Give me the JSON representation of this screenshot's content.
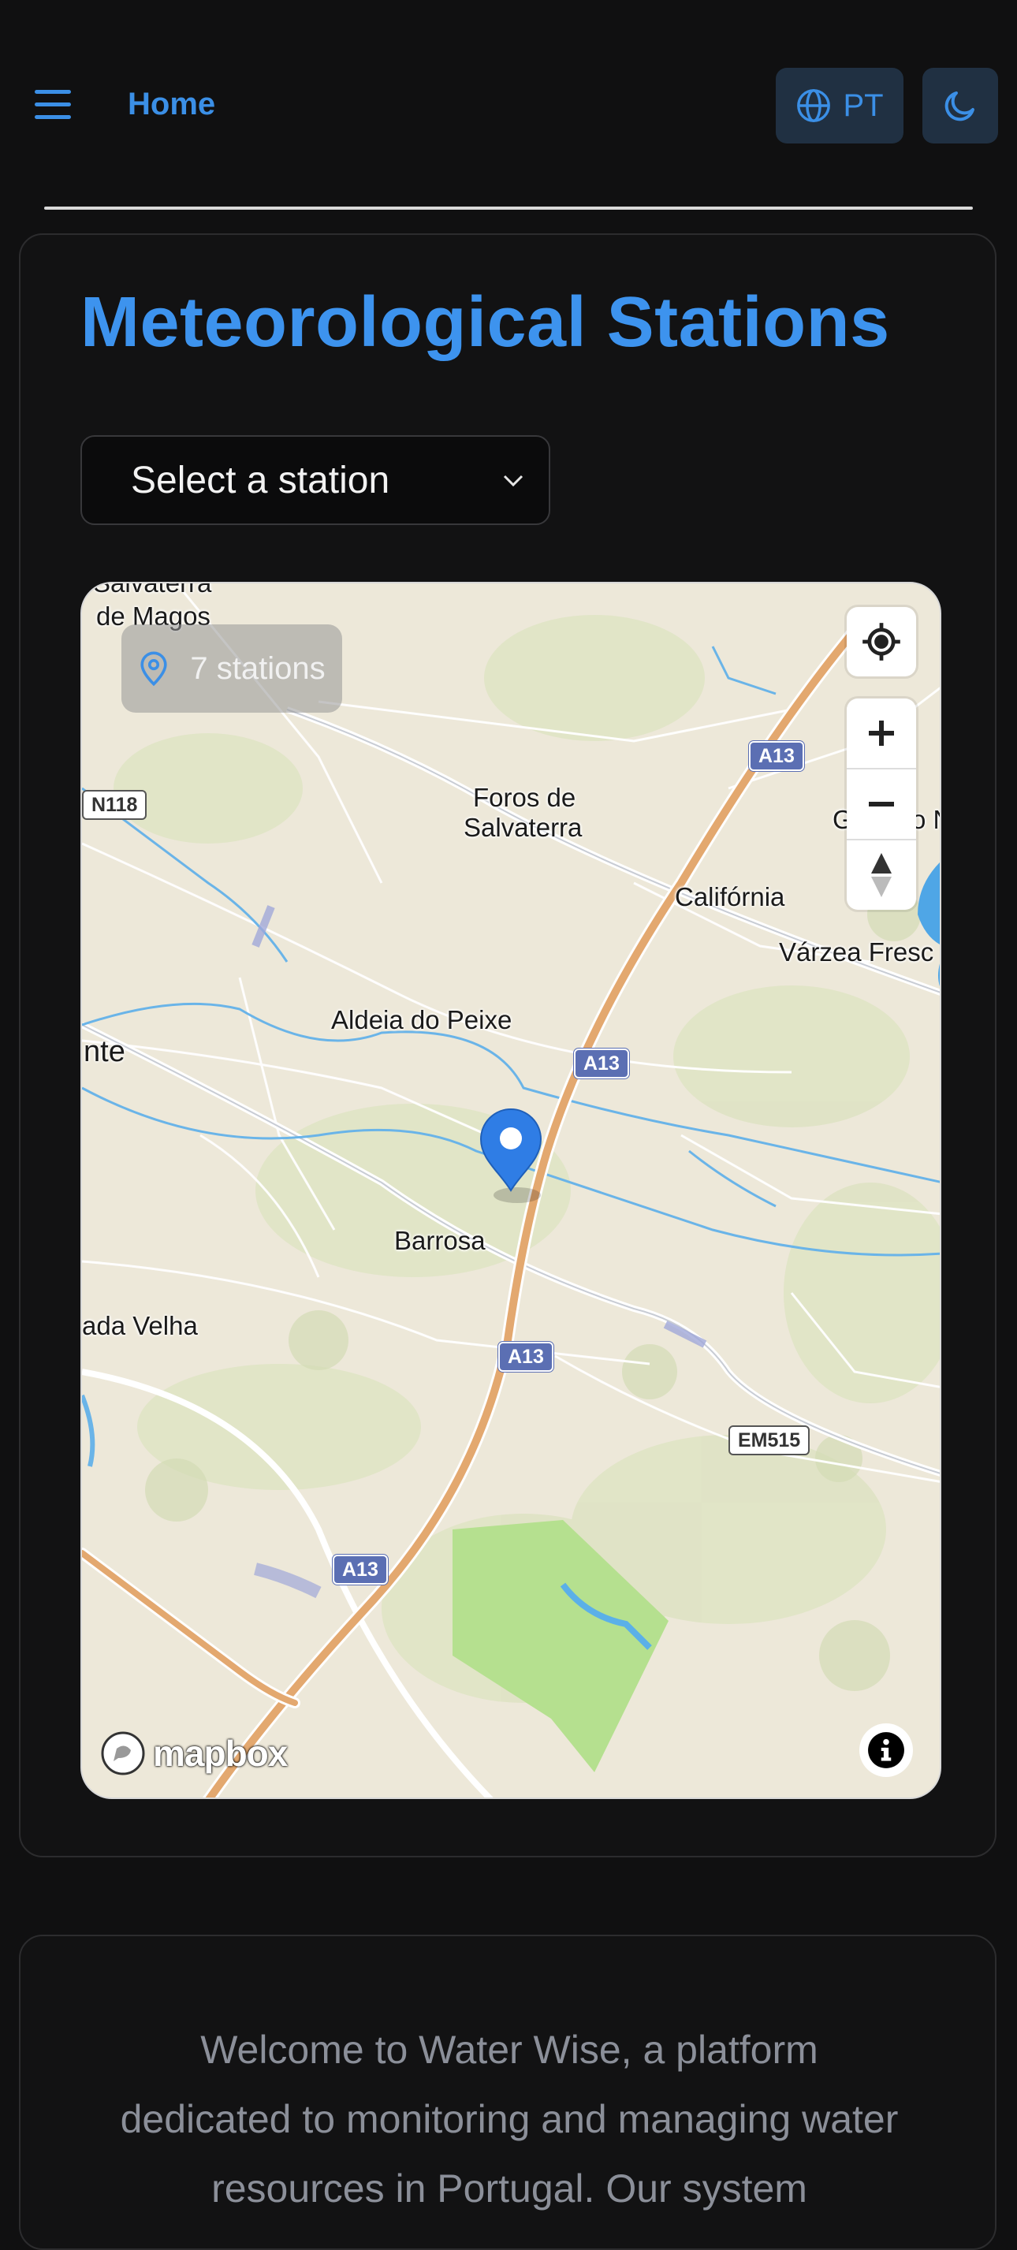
{
  "header": {
    "home_label": "Home",
    "language_label": "PT",
    "accent_color": "#3b8fe6"
  },
  "stations": {
    "title": "Meteorological Stations",
    "select_placeholder": "Select a station",
    "stations_count_label": "7 stations"
  },
  "map": {
    "attribution": "mapbox",
    "place_labels": {
      "salvaterra": "Salvaterra",
      "de_magos": "de Magos",
      "foros_line1": "Foros de",
      "foros_line2": "Salvaterra",
      "california": "Califórnia",
      "varzea": "Várzea Fresc",
      "gnorth": "G",
      "gnorth_tail": "o N",
      "aldeia": "Aldeia do Peixe",
      "nte": "nte",
      "barrosa": "Barrosa",
      "ada_velha": "ada Velha"
    },
    "road_shields": {
      "n118": "N118",
      "a13_top": "A13",
      "a13_mid": "A13",
      "a13_lower": "A13",
      "a13_bottom": "A13",
      "em515": "EM515"
    }
  },
  "welcome": {
    "text": "Welcome to Water Wise, a platform dedicated to monitoring and managing water resources in Portugal. Our system"
  }
}
